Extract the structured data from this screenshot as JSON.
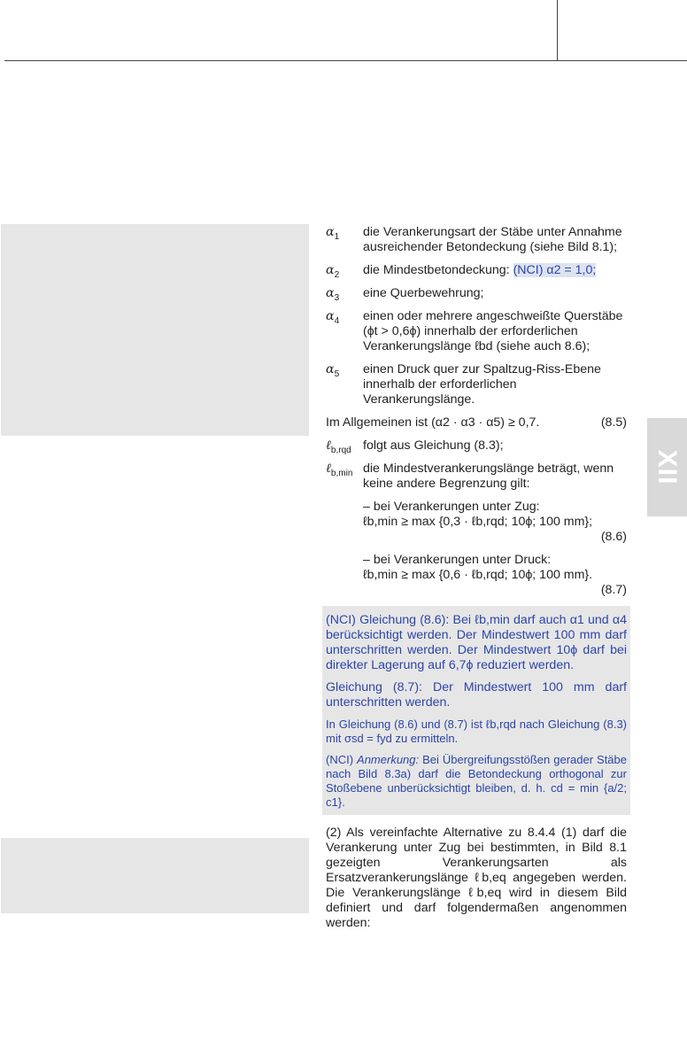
{
  "tab_label": "XII",
  "alpha": [
    {
      "sym": "α",
      "sub": "1",
      "text": "die Verankerungsart der Stäbe unter Annahme ausreichender Betondeckung (siehe Bild 8.1);"
    },
    {
      "sym": "α",
      "sub": "2",
      "text": "die Mindestbetondeckung: ",
      "nci": "(NCI) α2 = 1,0;"
    },
    {
      "sym": "α",
      "sub": "3",
      "text": "eine Querbewehrung;"
    },
    {
      "sym": "α",
      "sub": "4",
      "text": "einen oder mehrere angeschweißte Querstäbe (ϕt > 0,6ϕ) innerhalb der erforderlichen Verankerungslänge ℓbd (siehe auch 8.6);"
    },
    {
      "sym": "α",
      "sub": "5",
      "text": "einen Druck quer zur Spaltzug-Riss-Ebene innerhalb der erforderlichen Verankerungslänge."
    }
  ],
  "general": {
    "text": "Im Allgemeinen ist (α2 · α3 · α5) ≥ 0,7.",
    "eqno": "(8.5)"
  },
  "lb_rqd": {
    "sym": "ℓ",
    "sub": "b,rqd",
    "text": "folgt aus Gleichung (8.3);"
  },
  "lb_min": {
    "sym": "ℓ",
    "sub": "b,min",
    "text": "die Mindestverankerungslänge beträgt, wenn keine andere Begrenzung gilt:"
  },
  "zug": {
    "intro": "– bei Verankerungen unter Zug:",
    "formula": "ℓb,min ≥ max {0,3 · ℓb,rqd; 10ϕ; 100 mm};",
    "eqno": "(8.6)"
  },
  "druck": {
    "intro": "– bei Verankerungen unter Druck:",
    "formula": "ℓb,min ≥ max {0,6 · ℓb,rqd; 10ϕ; 100 mm}.",
    "eqno": "(8.7)"
  },
  "nci_box": {
    "p1": "(NCI) Gleichung (8.6): Bei ℓb,min darf auch α1 und α4 berücksichtigt werden. Der Mindestwert 100 mm darf unterschritten werden. Der Mindestwert 10ϕ darf bei direkter Lagerung auf 6,7ϕ reduziert werden.",
    "p2": "Gleichung (8.7): Der Mindestwert 100 mm darf unterschritten werden.",
    "p3": "In Gleichung (8.6) und (8.7) ist ℓb,rqd nach Gleichung (8.3) mit σsd = fyd zu ermitteln.",
    "p4_prefix": "(NCI) ",
    "p4_em": "Anmerkung:",
    "p4_rest": " Bei Übergreifungsstößen gerader Stäbe nach Bild 8.3a) darf die Betondeckung orthogonal zur Stoßebene unberücksichtigt bleiben, d. h. cd = min {a/2; c1}."
  },
  "para2": "(2) Als vereinfachte Alternative zu 8.4.4 (1) darf die Verankerung unter Zug bei bestimmten, in Bild 8.1 gezeigten Verankerungsarten als Ersatzverankerungslänge ℓb,eq angegeben werden. Die Verankerungslänge ℓb,eq wird in diesem Bild definiert und darf folgendermaßen angenommen werden:"
}
